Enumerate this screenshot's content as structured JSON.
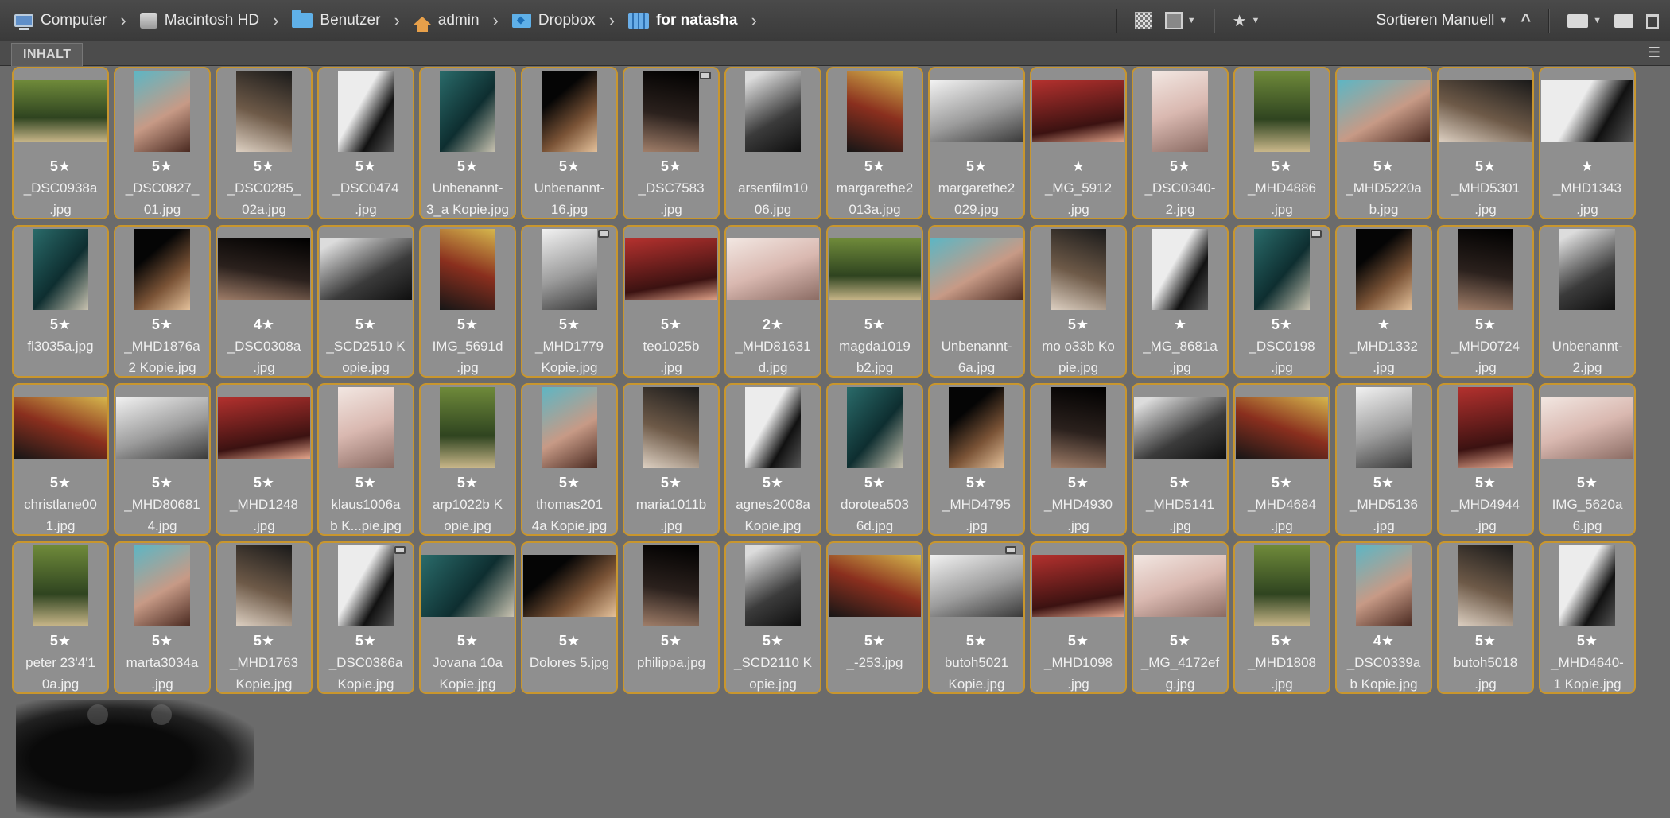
{
  "breadcrumb": [
    {
      "label": "Computer",
      "icon": "computer-icon"
    },
    {
      "label": "Macintosh HD",
      "icon": "hard-disk-icon"
    },
    {
      "label": "Benutzer",
      "icon": "users-folder-icon"
    },
    {
      "label": "admin",
      "icon": "home-folder-icon"
    },
    {
      "label": "Dropbox",
      "icon": "dropbox-folder-icon"
    },
    {
      "label": "for natasha",
      "icon": "grid-folder-icon"
    }
  ],
  "toolbar": {
    "sort_label": "Sortieren Manuell",
    "icons": [
      "checker-icon",
      "square-view-icon",
      "star-filter-icon",
      "sort-ascending-icon",
      "open-folder-icon",
      "new-folder-icon",
      "trash-icon"
    ]
  },
  "panel": {
    "tab_label": "INHALT"
  },
  "accent_color": "#c8962e",
  "thumbnails": [
    {
      "rating": "5★",
      "line1": "_DSC0938a",
      "line2": ".jpg"
    },
    {
      "rating": "5★",
      "line1": "_DSC0827_",
      "line2": "01.jpg"
    },
    {
      "rating": "5★",
      "line1": "_DSC0285_",
      "line2": "02a.jpg"
    },
    {
      "rating": "5★",
      "line1": "_DSC0474",
      "line2": ".jpg"
    },
    {
      "rating": "5★",
      "line1": "Unbenannt-",
      "line2": "3_a Kopie.jpg"
    },
    {
      "rating": "5★",
      "line1": "Unbenannt-",
      "line2": "16.jpg"
    },
    {
      "rating": "5★",
      "line1": "_DSC7583",
      "line2": ".jpg",
      "badge": true
    },
    {
      "rating": "",
      "line1": "arsenfilm10",
      "line2": "06.jpg"
    },
    {
      "rating": "5★",
      "line1": "margarethe2",
      "line2": "013a.jpg"
    },
    {
      "rating": "5★",
      "line1": "margarethe2",
      "line2": "029.jpg"
    },
    {
      "rating": "★",
      "line1": "_MG_5912",
      "line2": ".jpg"
    },
    {
      "rating": "5★",
      "line1": "_DSC0340-",
      "line2": "2.jpg"
    },
    {
      "rating": "5★",
      "line1": "_MHD4886",
      "line2": ".jpg"
    },
    {
      "rating": "5★",
      "line1": "_MHD5220a",
      "line2": "b.jpg"
    },
    {
      "rating": "5★",
      "line1": "_MHD5301",
      "line2": ".jpg"
    },
    {
      "rating": "★",
      "line1": "_MHD1343",
      "line2": ".jpg"
    },
    {
      "rating": "5★",
      "line1": "fl3035a.jpg",
      "line2": ""
    },
    {
      "rating": "5★",
      "line1": "_MHD1876a",
      "line2": "2 Kopie.jpg"
    },
    {
      "rating": "4★",
      "line1": "_DSC0308a",
      "line2": ".jpg"
    },
    {
      "rating": "5★",
      "line1": "_SCD2510 K",
      "line2": "opie.jpg"
    },
    {
      "rating": "5★",
      "line1": "IMG_5691d",
      "line2": ".jpg"
    },
    {
      "rating": "5★",
      "line1": "_MHD1779",
      "line2": "Kopie.jpg",
      "badge": true
    },
    {
      "rating": "5★",
      "line1": "teo1025b",
      "line2": ".jpg"
    },
    {
      "rating": "2★",
      "line1": "_MHD81631",
      "line2": "d.jpg"
    },
    {
      "rating": "5★",
      "line1": "magda1019",
      "line2": "b2.jpg"
    },
    {
      "rating": "",
      "line1": "Unbenannt-",
      "line2": "6a.jpg"
    },
    {
      "rating": "5★",
      "line1": "mo o33b Ko",
      "line2": "pie.jpg"
    },
    {
      "rating": "★",
      "line1": "_MG_8681a",
      "line2": ".jpg"
    },
    {
      "rating": "5★",
      "line1": "_DSC0198",
      "line2": ".jpg",
      "badge": true
    },
    {
      "rating": "★",
      "line1": "_MHD1332",
      "line2": ".jpg"
    },
    {
      "rating": "5★",
      "line1": "_MHD0724",
      "line2": ".jpg"
    },
    {
      "rating": "",
      "line1": "Unbenannt-",
      "line2": "2.jpg"
    },
    {
      "rating": "5★",
      "line1": "christlane00",
      "line2": "1.jpg"
    },
    {
      "rating": "5★",
      "line1": "_MHD80681",
      "line2": "4.jpg"
    },
    {
      "rating": "5★",
      "line1": "_MHD1248",
      "line2": ".jpg"
    },
    {
      "rating": "5★",
      "line1": "klaus1006a",
      "line2": "b K...pie.jpg"
    },
    {
      "rating": "5★",
      "line1": "arp1022b K",
      "line2": "opie.jpg"
    },
    {
      "rating": "5★",
      "line1": "thomas201",
      "line2": "4a Kopie.jpg"
    },
    {
      "rating": "5★",
      "line1": "maria1011b",
      "line2": ".jpg"
    },
    {
      "rating": "5★",
      "line1": "agnes2008a",
      "line2": "Kopie.jpg"
    },
    {
      "rating": "5★",
      "line1": "dorotea503",
      "line2": "6d.jpg"
    },
    {
      "rating": "5★",
      "line1": "_MHD4795",
      "line2": ".jpg"
    },
    {
      "rating": "5★",
      "line1": "_MHD4930",
      "line2": ".jpg"
    },
    {
      "rating": "5★",
      "line1": "_MHD5141",
      "line2": ".jpg"
    },
    {
      "rating": "5★",
      "line1": "_MHD4684",
      "line2": ".jpg"
    },
    {
      "rating": "5★",
      "line1": "_MHD5136",
      "line2": ".jpg"
    },
    {
      "rating": "5★",
      "line1": "_MHD4944",
      "line2": ".jpg"
    },
    {
      "rating": "5★",
      "line1": "IMG_5620a",
      "line2": "6.jpg"
    },
    {
      "rating": "5★",
      "line1": "peter 23'4'1",
      "line2": "0a.jpg"
    },
    {
      "rating": "5★",
      "line1": "marta3034a",
      "line2": ".jpg"
    },
    {
      "rating": "5★",
      "line1": "_MHD1763",
      "line2": "Kopie.jpg"
    },
    {
      "rating": "5★",
      "line1": "_DSC0386a",
      "line2": "Kopie.jpg",
      "badge": true
    },
    {
      "rating": "5★",
      "line1": "Jovana 10a",
      "line2": "Kopie.jpg"
    },
    {
      "rating": "5★",
      "line1": "Dolores 5.jpg",
      "line2": ""
    },
    {
      "rating": "5★",
      "line1": "philippa.jpg",
      "line2": ""
    },
    {
      "rating": "5★",
      "line1": "_SCD2110 K",
      "line2": "opie.jpg"
    },
    {
      "rating": "5★",
      "line1": "_-253.jpg",
      "line2": ""
    },
    {
      "rating": "5★",
      "line1": "butoh5021",
      "line2": "Kopie.jpg",
      "badge": true
    },
    {
      "rating": "5★",
      "line1": "_MHD1098",
      "line2": ".jpg"
    },
    {
      "rating": "5★",
      "line1": "_MG_4172ef",
      "line2": "g.jpg"
    },
    {
      "rating": "5★",
      "line1": "_MHD1808",
      "line2": ".jpg"
    },
    {
      "rating": "4★",
      "line1": "_DSC0339a",
      "line2": "b Kopie.jpg"
    },
    {
      "rating": "5★",
      "line1": "butoh5018",
      "line2": ".jpg"
    },
    {
      "rating": "5★",
      "line1": "_MHD4640-",
      "line2": "1 Kopie.jpg"
    }
  ]
}
